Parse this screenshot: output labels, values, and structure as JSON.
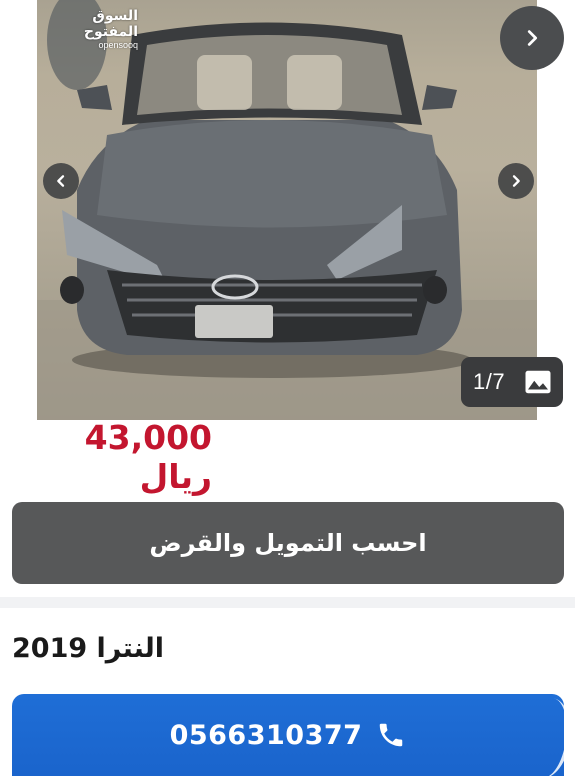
{
  "watermark": {
    "arabic": "السوق المفتوح",
    "english": "opensooq"
  },
  "gallery": {
    "counter": "1/7"
  },
  "listing": {
    "price": "43,000 ريال",
    "finance_button": "احسب التمويل والقرض",
    "title": "النترا 2019",
    "phone": "0566310377"
  },
  "icons": {
    "next": "chevron-right-icon",
    "prev": "chevron-left-icon",
    "gallery": "image-icon",
    "phone": "phone-icon"
  },
  "colors": {
    "price": "#c3162f",
    "finance_button": "#575859",
    "call_button": "#1f6ed6"
  }
}
